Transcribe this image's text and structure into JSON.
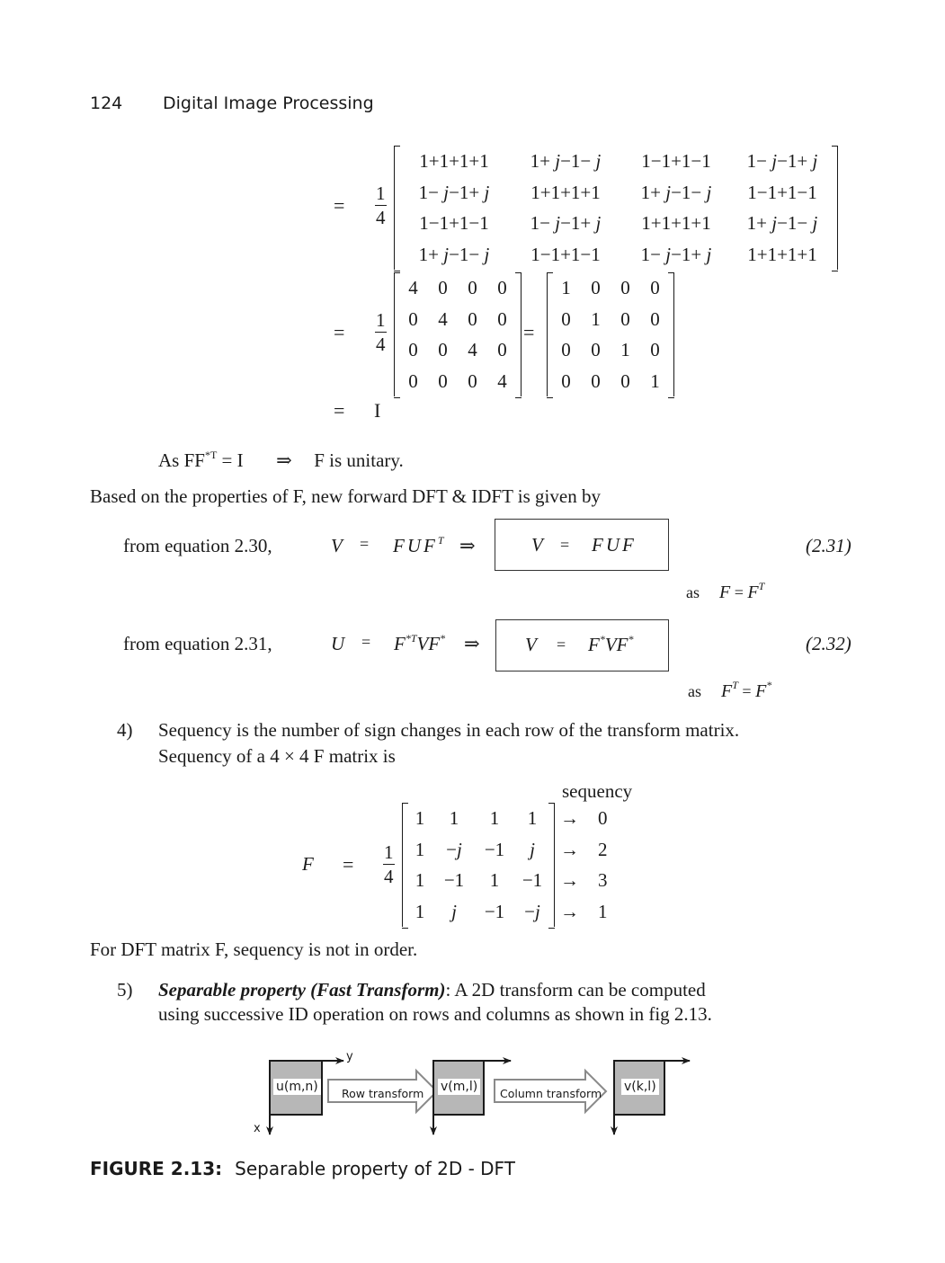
{
  "header": {
    "page_number": "124",
    "running_title": "Digital Image Processing"
  },
  "equations": {
    "equals": "=",
    "fraction": {
      "numerator": "1",
      "denominator": "4"
    },
    "matrix_expanded": [
      [
        "1+1+1+1",
        "1+ j−1− j",
        "1−1+1−1",
        "1− j−1+ j"
      ],
      [
        "1− j−1+ j",
        "1+1+1+1",
        "1+ j−1− j",
        "1−1+1−1"
      ],
      [
        "1−1+1−1",
        "1− j−1+ j",
        "1+1+1+1",
        "1+ j−1− j"
      ],
      [
        "1+ j−1− j",
        "1−1+1−1",
        "1− j−1+ j",
        "1+1+1+1"
      ]
    ],
    "matrix_diag4": [
      [
        "4",
        "0",
        "0",
        "0"
      ],
      [
        "0",
        "4",
        "0",
        "0"
      ],
      [
        "0",
        "0",
        "4",
        "0"
      ],
      [
        "0",
        "0",
        "0",
        "4"
      ]
    ],
    "matrix_identity": [
      [
        "1",
        "0",
        "0",
        "0"
      ],
      [
        "0",
        "1",
        "0",
        "0"
      ],
      [
        "0",
        "0",
        "1",
        "0"
      ],
      [
        "0",
        "0",
        "0",
        "1"
      ]
    ],
    "result_identity": "I"
  },
  "unitary_line": {
    "lhs": "As FF",
    "lhs_sup": "*T",
    "rest": " = I",
    "implies": "⇒",
    "conclusion": "F is unitary."
  },
  "paragraph_based": "Based on the properties of F, new forward DFT & IDFT is given by",
  "eq231": {
    "prefix": "from equation 2.30,",
    "lhs": "V",
    "eq": "=",
    "rhs": "FUF",
    "rhs_sup": "T",
    "implies": "⇒",
    "boxed_lhs": "V",
    "boxed_eq": "=",
    "boxed_rhs": "FUF",
    "number": "(2.31)",
    "note_as": "as",
    "note_lhs": "F",
    "note_eq": "=",
    "note_rhs": "F",
    "note_rhs_sup": "T"
  },
  "eq232": {
    "prefix": "from equation 2.31,",
    "lhs": "U",
    "eq": "=",
    "rhs_a": "F",
    "rhs_a_sup": "*T",
    "rhs_b": "VF",
    "rhs_b_sup": "*",
    "implies": "⇒",
    "boxed_lhs": "V",
    "boxed_eq": "=",
    "boxed_a": "F",
    "boxed_a_sup": "*",
    "boxed_b": "VF",
    "boxed_b_sup": "*",
    "number": "(2.32)",
    "note_as": "as",
    "note_lhs": "F",
    "note_lhs_sup": "T",
    "note_eq": "=",
    "note_rhs": "F",
    "note_rhs_sup": "*"
  },
  "item4": {
    "number": "4)",
    "line1": "Sequency is the number of sign changes in each row of the transform matrix.",
    "line2": "Sequency of a 4 × 4   F matrix is"
  },
  "sequency_eq": {
    "lhs": "F",
    "eq": "=",
    "column_header": "sequency",
    "matrix": [
      [
        "1",
        "1",
        "1",
        "1"
      ],
      [
        "1",
        "−j",
        "−1",
        "j"
      ],
      [
        "1",
        "−1",
        "1",
        "−1"
      ],
      [
        "1",
        "j",
        "−1",
        "−j"
      ]
    ],
    "arrow": "→",
    "sequency_values": [
      "0",
      "2",
      "3",
      "1"
    ]
  },
  "paragraph_order": "For DFT matrix F, sequency is not in order.",
  "item5": {
    "number": "5)",
    "title": "Separable property (Fast Transform)",
    "after_title": ":  A 2D transform can be computed",
    "line2": "using successive ID operation on rows and columns as shown in fig 2.13."
  },
  "figure": {
    "axis_y": "y",
    "axis_x": "x",
    "box1": "u(m,n)",
    "arrow1": "Row transform",
    "box2": "v(m,l)",
    "arrow2": "Column transform",
    "box3": "v(k,l)",
    "colors": {
      "box_fill": "#b7b7b7",
      "arrow_stroke": "#8a8a8a",
      "line": "#1a1a1a"
    }
  },
  "caption": {
    "label": "FIGURE 2.13:",
    "text": "Separable property of 2D - DFT"
  }
}
